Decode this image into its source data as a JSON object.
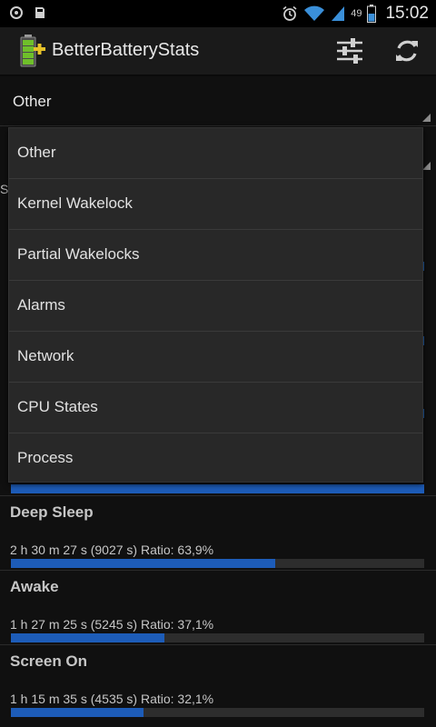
{
  "status_bar": {
    "battery_level": "49",
    "clock": "15:02"
  },
  "action_bar": {
    "title": "BetterBatteryStats",
    "icons": [
      "battery-app-icon",
      "settings-sliders-icon",
      "refresh-icon"
    ]
  },
  "spinner": {
    "selected": "Other",
    "peek_text": "S"
  },
  "dropdown": {
    "items": [
      {
        "label": "Other"
      },
      {
        "label": "Kernel Wakelock"
      },
      {
        "label": "Partial Wakelocks"
      },
      {
        "label": "Alarms"
      },
      {
        "label": "Network"
      },
      {
        "label": "CPU States"
      },
      {
        "label": "Process"
      }
    ]
  },
  "stats": [
    {
      "title": "Deep Sleep",
      "detail": "2 h 30 m 27 s  (9027 s) Ratio: 63,9%",
      "ratio": 0.639
    },
    {
      "title": "Awake",
      "detail": "1 h 27 m 25 s  (5245 s) Ratio: 37,1%",
      "ratio": 0.371
    },
    {
      "title": "Screen On",
      "detail": "1 h 15 m 35 s  (4535 s) Ratio: 32,1%",
      "ratio": 0.321
    }
  ],
  "top_bar_ratio": 1.0,
  "colors": {
    "accent_blue": "#1d5cb8",
    "background": "#101010",
    "dropdown_bg": "#282828"
  }
}
